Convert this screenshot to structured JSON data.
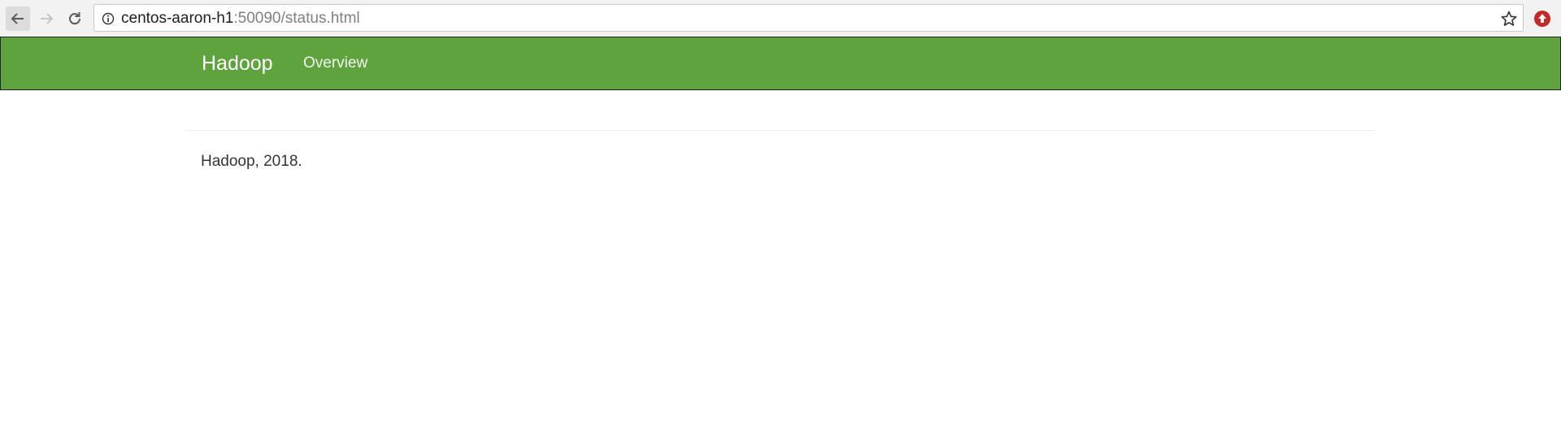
{
  "browser": {
    "url_host": "centos-aaron-h1",
    "url_rest": ":50090/status.html"
  },
  "navbar": {
    "brand": "Hadoop",
    "links": [
      {
        "label": "Overview"
      }
    ],
    "color": "#5fa33e"
  },
  "footer": {
    "text": "Hadoop, 2018."
  }
}
